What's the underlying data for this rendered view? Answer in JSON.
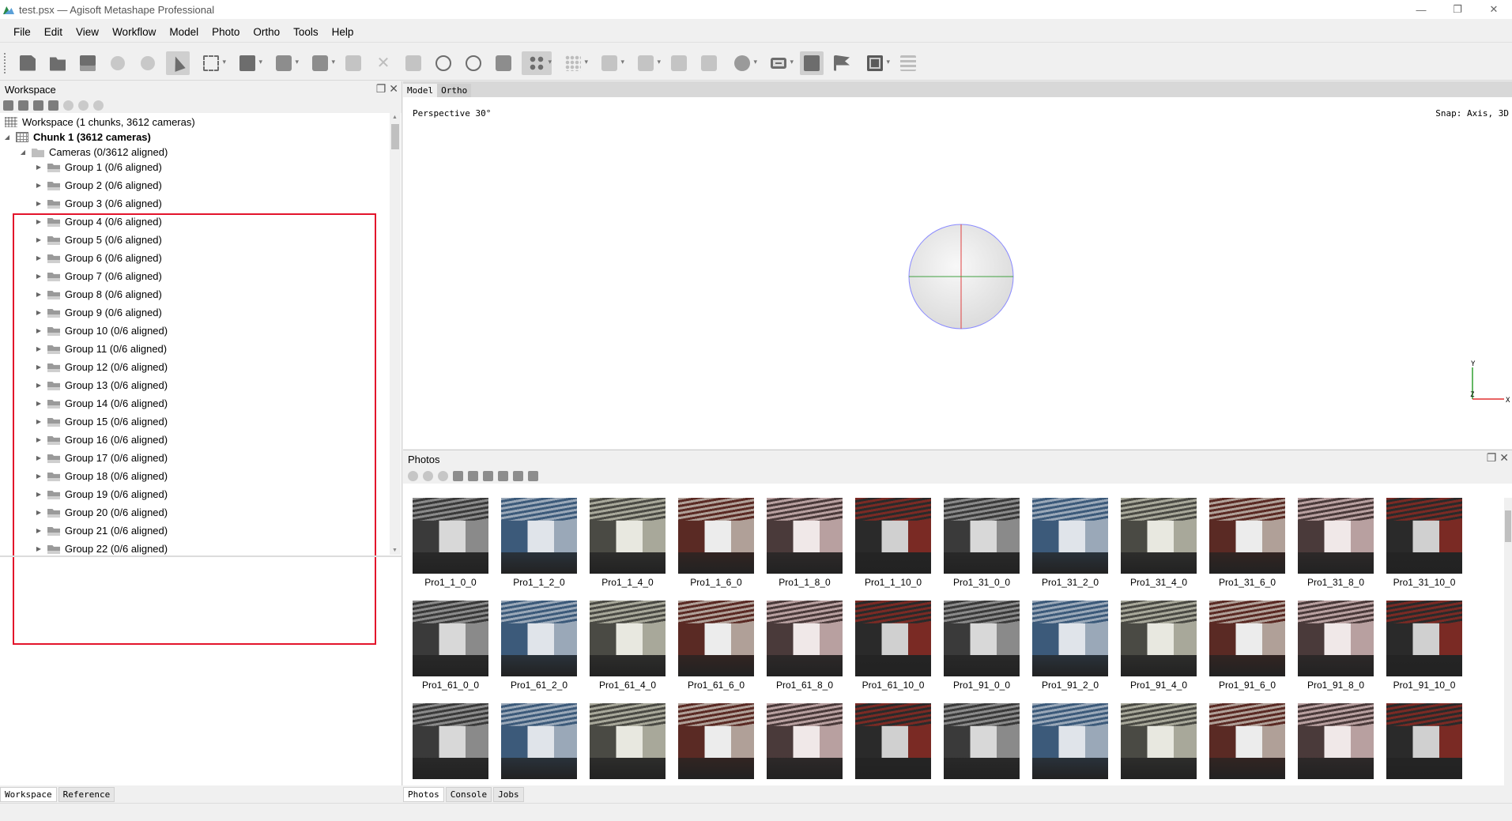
{
  "window": {
    "title": "test.psx — Agisoft Metashape Professional"
  },
  "menu": [
    "File",
    "Edit",
    "View",
    "Workflow",
    "Model",
    "Photo",
    "Ortho",
    "Tools",
    "Help"
  ],
  "workspace": {
    "title": "Workspace",
    "root_label": "Workspace (1 chunks, 3612 cameras)",
    "chunk_label": "Chunk 1 (3612 cameras)",
    "cameras_label": "Cameras (0/3612 aligned)",
    "groups": [
      "Group 1 (0/6 aligned)",
      "Group 2 (0/6 aligned)",
      "Group 3 (0/6 aligned)",
      "Group 4 (0/6 aligned)",
      "Group 5 (0/6 aligned)",
      "Group 6 (0/6 aligned)",
      "Group 7 (0/6 aligned)",
      "Group 8 (0/6 aligned)",
      "Group 9 (0/6 aligned)",
      "Group 10 (0/6 aligned)",
      "Group 11 (0/6 aligned)",
      "Group 12 (0/6 aligned)",
      "Group 13 (0/6 aligned)",
      "Group 14 (0/6 aligned)",
      "Group 15 (0/6 aligned)",
      "Group 16 (0/6 aligned)",
      "Group 17 (0/6 aligned)",
      "Group 18 (0/6 aligned)",
      "Group 19 (0/6 aligned)",
      "Group 20 (0/6 aligned)",
      "Group 21 (0/6 aligned)",
      "Group 22 (0/6 aligned)"
    ],
    "bottom_tabs": [
      "Workspace",
      "Reference"
    ]
  },
  "model_view": {
    "tabs": [
      "Model",
      "Ortho"
    ],
    "perspective": "Perspective 30°",
    "snap": "Snap: Axis, 3D",
    "axis_y": "Y",
    "axis_z": "Z",
    "axis_x": "X"
  },
  "photos": {
    "title": "Photos",
    "items": [
      "Pro1_1_0_0",
      "Pro1_1_2_0",
      "Pro1_1_4_0",
      "Pro1_1_6_0",
      "Pro1_1_8_0",
      "Pro1_1_10_0",
      "Pro1_31_0_0",
      "Pro1_31_2_0",
      "Pro1_31_4_0",
      "Pro1_31_6_0",
      "Pro1_31_8_0",
      "Pro1_31_10_0",
      "Pro1_61_0_0",
      "Pro1_61_2_0",
      "Pro1_61_4_0",
      "Pro1_61_6_0",
      "Pro1_61_8_0",
      "Pro1_61_10_0",
      "Pro1_91_0_0",
      "Pro1_91_2_0",
      "Pro1_91_4_0",
      "Pro1_91_6_0",
      "Pro1_91_8_0",
      "Pro1_91_10_0",
      "",
      "",
      "",
      "",
      "",
      "",
      "",
      "",
      "",
      "",
      "",
      ""
    ],
    "bottom_tabs": [
      "Photos",
      "Console",
      "Jobs"
    ]
  },
  "colors": {
    "highlight": "#e3142b",
    "axis_x": "#e03030",
    "axis_y": "#30a030"
  }
}
